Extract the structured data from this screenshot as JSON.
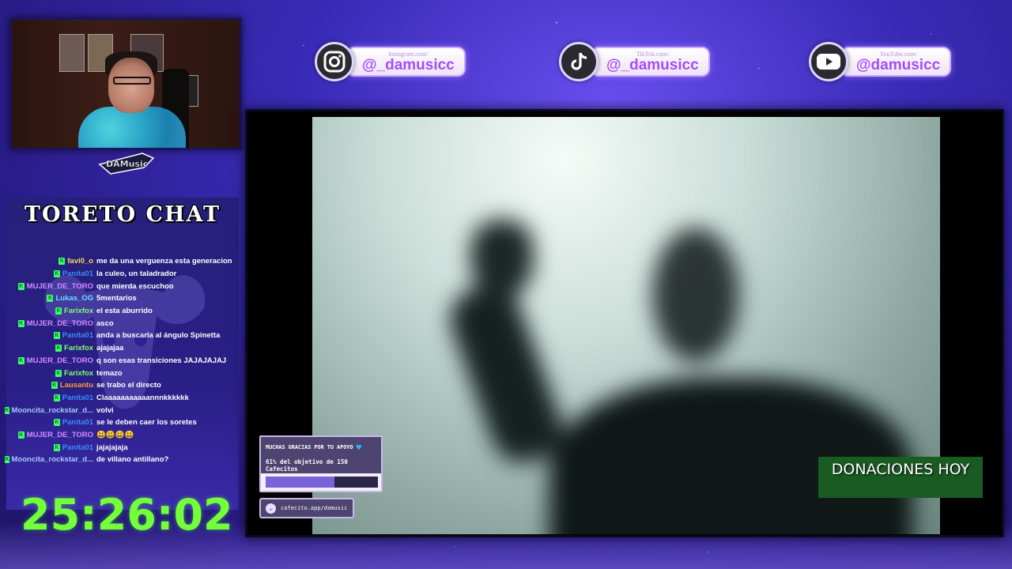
{
  "socials": [
    {
      "platform_label": "Instagram.com/",
      "handle": "@_damusicc",
      "icon": "instagram-icon"
    },
    {
      "platform_label": "TikTok.com/",
      "handle": "@_damusicc",
      "icon": "tiktok-icon"
    },
    {
      "platform_label": "YouTube.com/",
      "handle": "@damusicc",
      "icon": "youtube-icon"
    }
  ],
  "chat": {
    "title": "TORETO CHAT",
    "messages": [
      {
        "user": "favi0_o",
        "text": "me da una verguenza esta generacion",
        "color": "#ffd84a"
      },
      {
        "user": "Panita01",
        "text": "la culeo, un taladrador",
        "color": "#3a8cff"
      },
      {
        "user": "MUJER_DE_TORO",
        "text": "que mierda escuchoo",
        "color": "#d58cff"
      },
      {
        "user": "Lukas_OG",
        "text": "5mentarios",
        "color": "#66e0ff"
      },
      {
        "user": "Farixfox",
        "text": "el esta aburrido",
        "color": "#7dff6a"
      },
      {
        "user": "MUJER_DE_TORO",
        "text": "asco",
        "color": "#d58cff"
      },
      {
        "user": "Panita01",
        "text": "anda a buscarla al ángulo Spinetta",
        "color": "#3a8cff"
      },
      {
        "user": "Farixfox",
        "text": "ajajajaa",
        "color": "#7dff6a"
      },
      {
        "user": "MUJER_DE_TORO",
        "text": "q son esas transiciones JAJAJAJAJ",
        "color": "#d58cff"
      },
      {
        "user": "Farixfox",
        "text": "temazo",
        "color": "#7dff6a"
      },
      {
        "user": "Lausantu",
        "text": "se trabo el directo",
        "color": "#ff9a3a"
      },
      {
        "user": "Panita01",
        "text": "Claaaaaaaaaaannnkkkkkk",
        "color": "#3a8cff"
      },
      {
        "user": "Mooncita_rockstar_d...",
        "text": "volvi",
        "color": "#a9c8ff"
      },
      {
        "user": "Panita01",
        "text": "se le deben caer los soretes",
        "color": "#3a8cff"
      },
      {
        "user": "MUJER_DE_TORO",
        "text": "😃😃😃😃",
        "color": "#d58cff"
      },
      {
        "user": "Panita01",
        "text": "jajajajaja",
        "color": "#3a8cff"
      },
      {
        "user": "Mooncita_rockstar_d...",
        "text": "de villano antillano?",
        "color": "#a9c8ff"
      }
    ]
  },
  "timer": "25:26:02",
  "donations": {
    "label": "DONACIONES HOY"
  },
  "support": {
    "title": "MUCHAS GRACIAS POR TU APOYO",
    "progress_text": "61% del objetivo de 150 Cafecitos",
    "progress_fraction": 0.61,
    "link": "cafecito.app/damusic"
  },
  "logo_text": "DAMUSIC",
  "colors": {
    "accent": "#a24bff",
    "timer": "#73ff3a",
    "badge": "#3cff6a"
  }
}
